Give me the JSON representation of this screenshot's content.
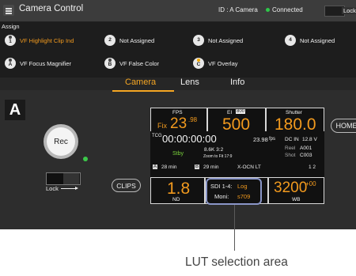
{
  "header": {
    "title": "Camera Control",
    "id_text": "ID : A Camera",
    "status": "Connected",
    "lock_label": "Lock"
  },
  "assign": {
    "label": "Assign",
    "keys": [
      {
        "badge": "1",
        "label": "VF Highlight Clip Ind"
      },
      {
        "badge": "2",
        "label": "Not Assigned"
      },
      {
        "badge": "3",
        "label": "Not Assigned"
      },
      {
        "badge": "4",
        "label": "Not Assigned"
      },
      {
        "badge": "A",
        "label": "VF Focus Magnifier"
      },
      {
        "badge": "B",
        "label": "VF False Color"
      },
      {
        "badge": "C",
        "label": "VF Overlay"
      }
    ]
  },
  "tabs": [
    {
      "label": "Camera"
    },
    {
      "label": "Lens"
    },
    {
      "label": "Info"
    }
  ],
  "camera_badge": "A",
  "rec_label": "Rec",
  "lock_switch_label": "Lock",
  "clips_label": "CLIPS",
  "home_label": "HOME",
  "panel": {
    "fps": {
      "label": "FPS",
      "prefix": "Fix",
      "value": "23",
      "sup": ".98"
    },
    "ei": {
      "label": "EI",
      "badge": "800",
      "value": "500"
    },
    "shutter": {
      "label": "Shutter",
      "value": "180.0"
    },
    "tc": {
      "label": "TCG",
      "value": "00:00:00:00",
      "rate": "23.98",
      "rate_unit": "fps"
    },
    "dc": {
      "label": "DC IN",
      "value": "12.8 V"
    },
    "reel": {
      "label": "Reel",
      "value": "A001"
    },
    "shot": {
      "label": "Shot",
      "value": "C003"
    },
    "status": "Stby",
    "imager": {
      "mode": "8.6K 3:2",
      "zoom": "Zoom to Fit 17:9"
    },
    "media_a": {
      "slot": "A",
      "value": "28 min"
    },
    "media_b": {
      "slot": "B",
      "value": "29 min"
    },
    "media_name": "X-OCN LT",
    "page": "1  2",
    "nd": {
      "label": "ND",
      "value": "1.8"
    },
    "lut": {
      "line1_label": "SDI 1-4:",
      "line1_value": "Log",
      "line2_label": "Moni:",
      "line2_value": "s709"
    },
    "wb": {
      "label": "WB",
      "value": "3200",
      "offset": "+00"
    }
  },
  "callout": "LUT selection area",
  "colors": {
    "accent": "#f29a1e",
    "tab_active": "#f5a623",
    "connected": "#2ec84a",
    "lut_highlight": "#8a96c8"
  }
}
